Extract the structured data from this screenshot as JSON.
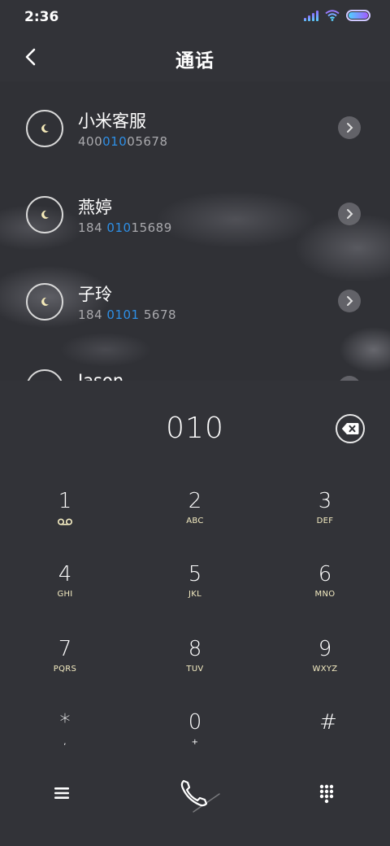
{
  "status_bar": {
    "time": "2:36",
    "icons": [
      "signal-icon",
      "wifi-icon",
      "battery-icon"
    ],
    "accent_colors": [
      "#8f6bff",
      "#4fd1ff"
    ]
  },
  "header": {
    "back_icon": "chevron-left-icon",
    "title": "通话"
  },
  "results": [
    {
      "name": "小米客服",
      "number_pre": "400",
      "number_match": "010",
      "number_post": "05678"
    },
    {
      "name": "燕婷",
      "number_pre": "184 ",
      "number_match": "010",
      "number_post": "15689"
    },
    {
      "name": "子玲",
      "number_pre": "184 ",
      "number_match": "0101",
      "number_post": " 5678"
    },
    {
      "name": "Jason",
      "number_pre": "",
      "number_match": "",
      "number_post": ""
    }
  ],
  "highlight_color": "#2e8fe6",
  "dialer": {
    "input": "010",
    "backspace_icon": "backspace-icon",
    "keys": [
      {
        "digit": "1",
        "letters": "",
        "icon": "voicemail-icon"
      },
      {
        "digit": "2",
        "letters": "ABC"
      },
      {
        "digit": "3",
        "letters": "DEF"
      },
      {
        "digit": "4",
        "letters": "GHI"
      },
      {
        "digit": "5",
        "letters": "JKL"
      },
      {
        "digit": "6",
        "letters": "MNO"
      },
      {
        "digit": "7",
        "letters": "PQRS"
      },
      {
        "digit": "8",
        "letters": "TUV"
      },
      {
        "digit": "9",
        "letters": "WXYZ"
      },
      {
        "digit": "*",
        "letters": ","
      },
      {
        "digit": "0",
        "letters": "+"
      },
      {
        "digit": "#",
        "letters": ""
      }
    ],
    "bottom_icons": [
      "menu-icon",
      "phone-icon",
      "keypad-icon"
    ]
  }
}
